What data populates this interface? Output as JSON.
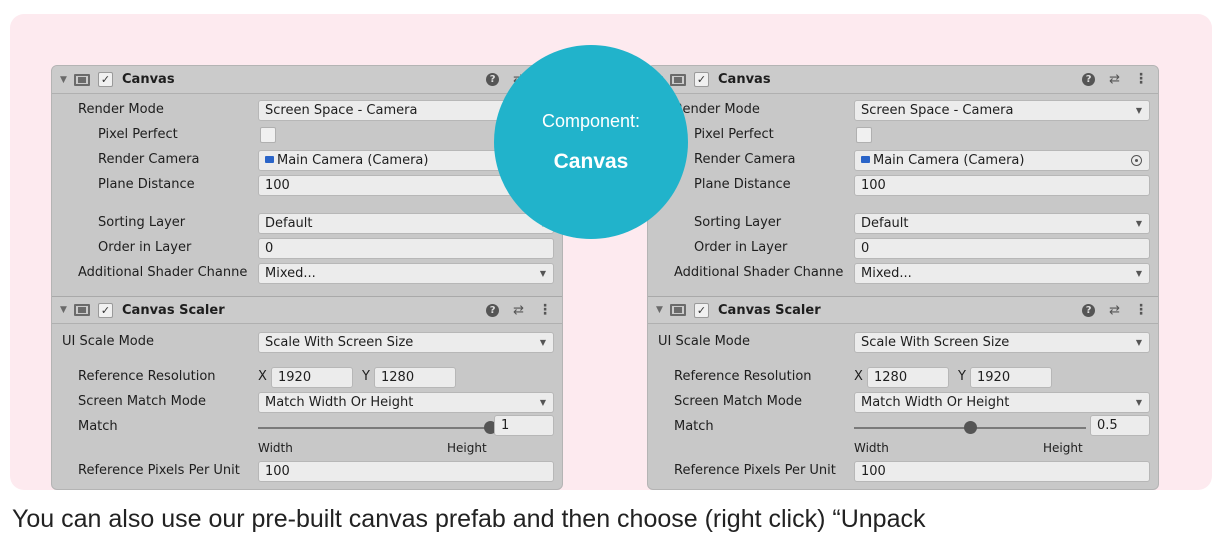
{
  "badge": {
    "line1": "Component:",
    "line2": "Canvas"
  },
  "left": {
    "canvas": {
      "title": "Canvas",
      "render_mode_label": "Render Mode",
      "render_mode_value": "Screen Space - Camera",
      "pixel_perfect_label": "Pixel Perfect",
      "render_camera_label": "Render Camera",
      "render_camera_value": "Main Camera (Camera)",
      "plane_distance_label": "Plane Distance",
      "plane_distance_value": "100",
      "sorting_layer_label": "Sorting Layer",
      "sorting_layer_value": "Default",
      "order_label": "Order in Layer",
      "order_value": "0",
      "shader_label": "Additional Shader Channe",
      "shader_value": "Mixed..."
    },
    "scaler": {
      "title": "Canvas Scaler",
      "ui_scale_label": "UI Scale Mode",
      "ui_scale_value": "Scale With Screen Size",
      "ref_res_label": "Reference Resolution",
      "x_tag": "X",
      "x_value": "1920",
      "y_tag": "Y",
      "y_value": "1280",
      "match_mode_label": "Screen Match Mode",
      "match_mode_value": "Match Width Or Height",
      "match_label": "Match",
      "match_value": "1",
      "match_fraction": 1,
      "width_caption": "Width",
      "height_caption": "Height",
      "ppu_label": "Reference Pixels Per Unit",
      "ppu_value": "100"
    }
  },
  "right": {
    "canvas": {
      "title": "Canvas",
      "render_mode_label": "Render Mode",
      "render_mode_value": "Screen Space - Camera",
      "pixel_perfect_label": "Pixel Perfect",
      "render_camera_label": "Render Camera",
      "render_camera_value": "Main Camera (Camera)",
      "plane_distance_label": "Plane Distance",
      "plane_distance_value": "100",
      "sorting_layer_label": "Sorting Layer",
      "sorting_layer_value": "Default",
      "order_label": "Order in Layer",
      "order_value": "0",
      "shader_label": "Additional Shader Channe",
      "shader_value": "Mixed..."
    },
    "scaler": {
      "title": "Canvas Scaler",
      "ui_scale_label": "UI Scale Mode",
      "ui_scale_value": "Scale With Screen Size",
      "ref_res_label": "Reference Resolution",
      "x_tag": "X",
      "x_value": "1280",
      "y_tag": "Y",
      "y_value": "1920",
      "match_mode_label": "Screen Match Mode",
      "match_mode_value": "Match Width Or Height",
      "match_label": "Match",
      "match_value": "0.5",
      "match_fraction": 0.5,
      "width_caption": "Width",
      "height_caption": "Height",
      "ppu_label": "Reference Pixels Per Unit",
      "ppu_value": "100"
    }
  },
  "icons": {
    "fold": "triangle-down-icon",
    "component": "canvas-component-icon",
    "help": "help-icon",
    "preset": "preset-icon",
    "menu": "kebab-menu-icon",
    "camera": "camera-icon",
    "object_picker": "object-picker-icon"
  },
  "colors": {
    "badge": "#21b3cb",
    "card_background": "#fdeaef",
    "inspector": "#c8c8c8"
  },
  "caption": "You can also use our pre-built canvas prefab and then choose (right click) “Unpack"
}
